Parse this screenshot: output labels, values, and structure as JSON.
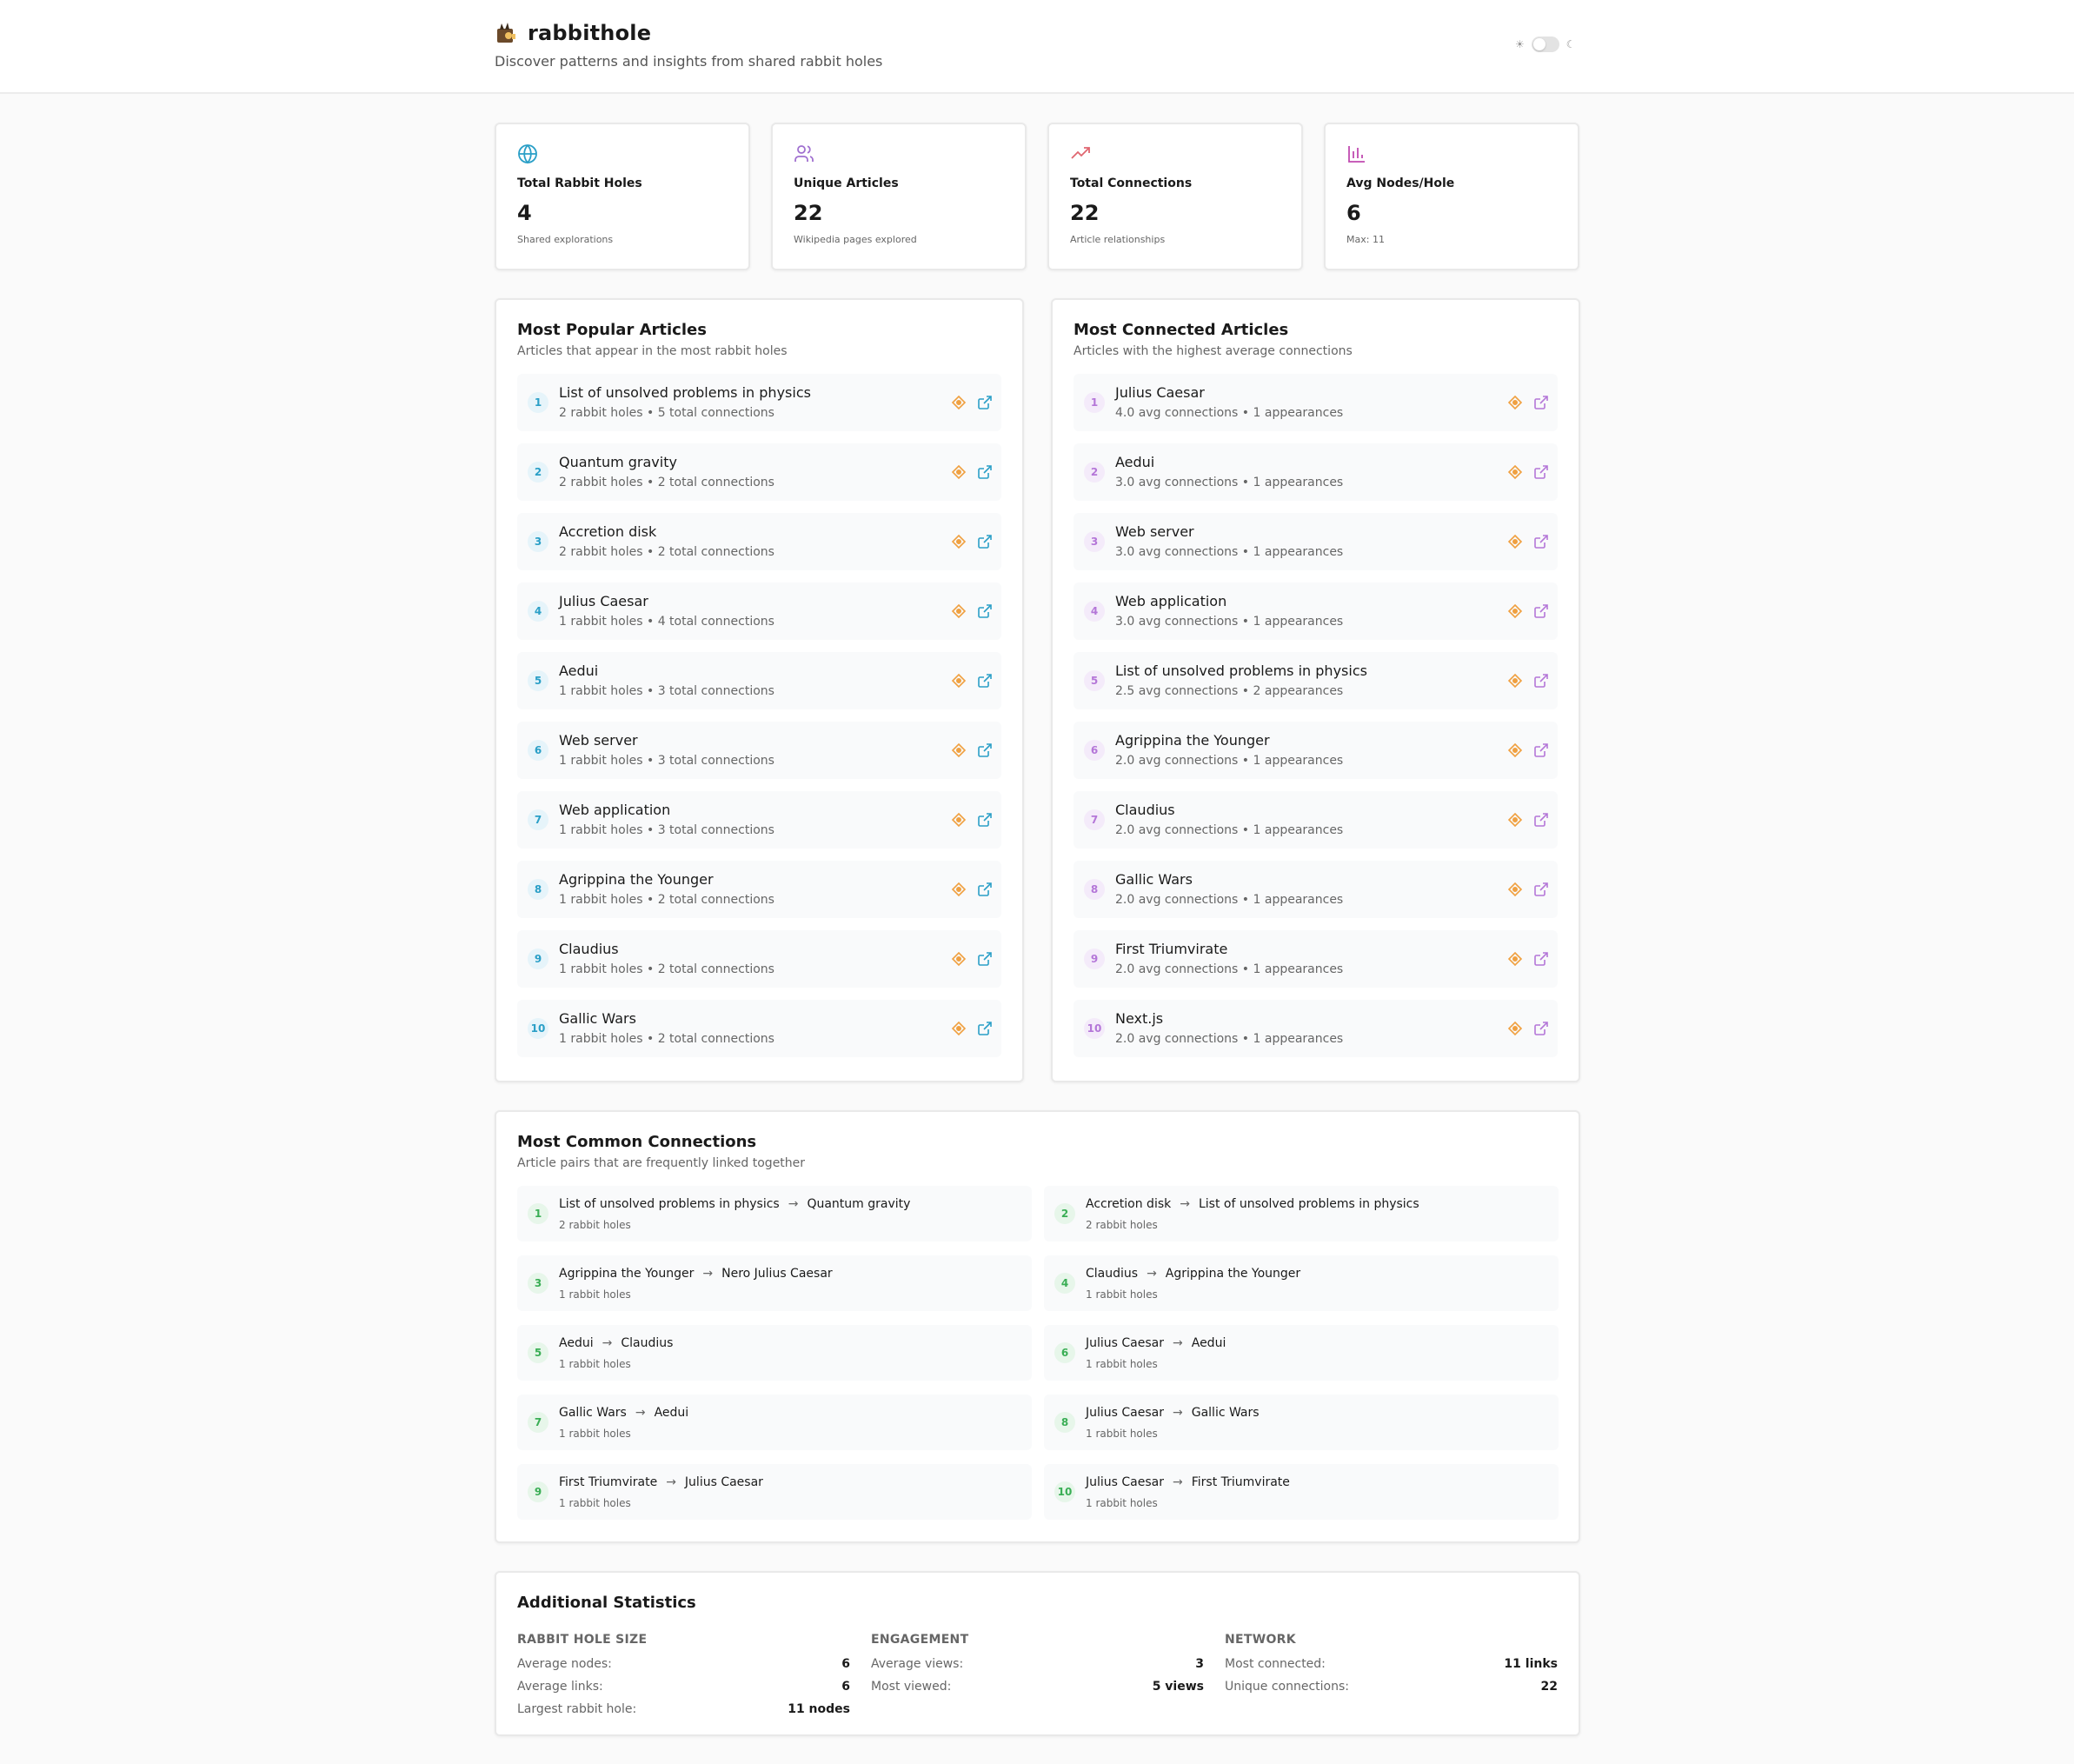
{
  "header": {
    "title": "rabbithole",
    "subtitle": "Discover patterns and insights from shared rabbit holes",
    "toggle_sun_glyph": "☀",
    "toggle_moon_glyph": "☾"
  },
  "stats": [
    {
      "icon": "globe-icon",
      "label": "Total Rabbit Holes",
      "value": "4",
      "sub": "Shared explorations",
      "color": "#2a9fc7"
    },
    {
      "icon": "users-icon",
      "label": "Unique Articles",
      "value": "22",
      "sub": "Wikipedia pages explored",
      "color": "#a070d0"
    },
    {
      "icon": "trending-up-icon",
      "label": "Total Connections",
      "value": "22",
      "sub": "Article relationships",
      "color": "#e06670"
    },
    {
      "icon": "bar-chart-icon",
      "label": "Avg Nodes/Hole",
      "value": "6",
      "sub": "Max: 11",
      "color": "#c04ab0"
    }
  ],
  "popular": {
    "title": "Most Popular Articles",
    "subtitle": "Articles that appear in the most rabbit holes",
    "items": [
      {
        "rank": "1",
        "title": "List of unsolved problems in physics",
        "meta": "2 rabbit holes • 5 total connections"
      },
      {
        "rank": "2",
        "title": "Quantum gravity",
        "meta": "2 rabbit holes • 2 total connections"
      },
      {
        "rank": "3",
        "title": "Accretion disk",
        "meta": "2 rabbit holes • 2 total connections"
      },
      {
        "rank": "4",
        "title": "Julius Caesar",
        "meta": "1 rabbit holes • 4 total connections"
      },
      {
        "rank": "5",
        "title": "Aedui",
        "meta": "1 rabbit holes • 3 total connections"
      },
      {
        "rank": "6",
        "title": "Web server",
        "meta": "1 rabbit holes • 3 total connections"
      },
      {
        "rank": "7",
        "title": "Web application",
        "meta": "1 rabbit holes • 3 total connections"
      },
      {
        "rank": "8",
        "title": "Agrippina the Younger",
        "meta": "1 rabbit holes • 2 total connections"
      },
      {
        "rank": "9",
        "title": "Claudius",
        "meta": "1 rabbit holes • 2 total connections"
      },
      {
        "rank": "10",
        "title": "Gallic Wars",
        "meta": "1 rabbit holes • 2 total connections"
      }
    ]
  },
  "connected": {
    "title": "Most Connected Articles",
    "subtitle": "Articles with the highest average connections",
    "items": [
      {
        "rank": "1",
        "title": "Julius Caesar",
        "meta": "4.0 avg connections • 1 appearances"
      },
      {
        "rank": "2",
        "title": "Aedui",
        "meta": "3.0 avg connections • 1 appearances"
      },
      {
        "rank": "3",
        "title": "Web server",
        "meta": "3.0 avg connections • 1 appearances"
      },
      {
        "rank": "4",
        "title": "Web application",
        "meta": "3.0 avg connections • 1 appearances"
      },
      {
        "rank": "5",
        "title": "List of unsolved problems in physics",
        "meta": "2.5 avg connections • 2 appearances"
      },
      {
        "rank": "6",
        "title": "Agrippina the Younger",
        "meta": "2.0 avg connections • 1 appearances"
      },
      {
        "rank": "7",
        "title": "Claudius",
        "meta": "2.0 avg connections • 1 appearances"
      },
      {
        "rank": "8",
        "title": "Gallic Wars",
        "meta": "2.0 avg connections • 1 appearances"
      },
      {
        "rank": "9",
        "title": "First Triumvirate",
        "meta": "2.0 avg connections • 1 appearances"
      },
      {
        "rank": "10",
        "title": "Next.js",
        "meta": "2.0 avg connections • 1 appearances"
      }
    ]
  },
  "connections": {
    "title": "Most Common Connections",
    "subtitle": "Article pairs that are frequently linked together",
    "items": [
      {
        "rank": "1",
        "from": "List of unsolved problems in physics",
        "to": "Quantum gravity",
        "meta": "2 rabbit holes"
      },
      {
        "rank": "2",
        "from": "Accretion disk",
        "to": "List of unsolved problems in physics",
        "meta": "2 rabbit holes"
      },
      {
        "rank": "3",
        "from": "Agrippina the Younger",
        "to": "Nero Julius Caesar",
        "meta": "1 rabbit holes"
      },
      {
        "rank": "4",
        "from": "Claudius",
        "to": "Agrippina the Younger",
        "meta": "1 rabbit holes"
      },
      {
        "rank": "5",
        "from": "Aedui",
        "to": "Claudius",
        "meta": "1 rabbit holes"
      },
      {
        "rank": "6",
        "from": "Julius Caesar",
        "to": "Aedui",
        "meta": "1 rabbit holes"
      },
      {
        "rank": "7",
        "from": "Gallic Wars",
        "to": "Aedui",
        "meta": "1 rabbit holes"
      },
      {
        "rank": "8",
        "from": "Julius Caesar",
        "to": "Gallic Wars",
        "meta": "1 rabbit holes"
      },
      {
        "rank": "9",
        "from": "First Triumvirate",
        "to": "Julius Caesar",
        "meta": "1 rabbit holes"
      },
      {
        "rank": "10",
        "from": "Julius Caesar",
        "to": "First Triumvirate",
        "meta": "1 rabbit holes"
      }
    ]
  },
  "additional": {
    "title": "Additional Statistics",
    "groups": [
      {
        "heading": "RABBIT HOLE SIZE",
        "rows": [
          {
            "k": "Average nodes:",
            "v": "6"
          },
          {
            "k": "Average links:",
            "v": "6"
          },
          {
            "k": "Largest rabbit hole:",
            "v": "11 nodes"
          }
        ]
      },
      {
        "heading": "ENGAGEMENT",
        "rows": [
          {
            "k": "Average views:",
            "v": "3"
          },
          {
            "k": "Most viewed:",
            "v": "5 views"
          }
        ]
      },
      {
        "heading": "NETWORK",
        "rows": [
          {
            "k": "Most connected:",
            "v": "11 links"
          },
          {
            "k": "Unique connections:",
            "v": "22"
          }
        ]
      }
    ]
  },
  "colors": {
    "accent_blue": "#2a9fc7",
    "accent_purple": "#b476d8",
    "accent_green": "#3aae55",
    "node_icon_orange": "#f0a040"
  }
}
